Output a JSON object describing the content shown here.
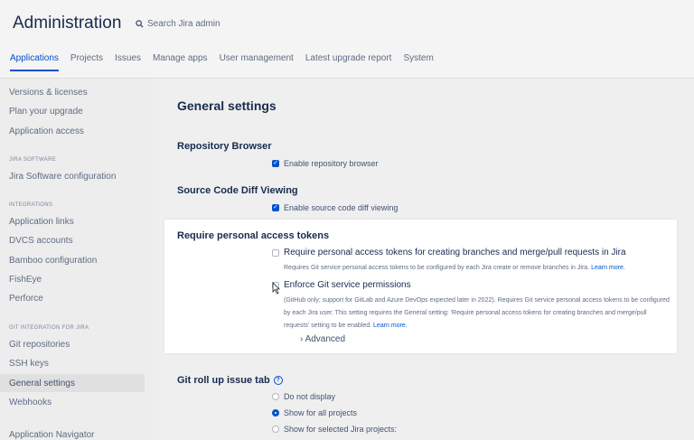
{
  "header": {
    "title": "Administration",
    "search_placeholder": "Search Jira admin",
    "tabs": [
      "Applications",
      "Projects",
      "Issues",
      "Manage apps",
      "User management",
      "Latest upgrade report",
      "System"
    ]
  },
  "sidebar": {
    "items_top": [
      "Versions & licenses",
      "Plan your upgrade",
      "Application access"
    ],
    "heading_jira_software": "JIRA SOFTWARE",
    "jira_software_items": [
      "Jira Software configuration"
    ],
    "heading_integrations": "INTEGRATIONS",
    "integration_items": [
      "Application links",
      "DVCS accounts",
      "Bamboo configuration",
      "FishEye",
      "Perforce"
    ],
    "heading_git": "GIT INTEGRATION FOR JIRA",
    "git_items": [
      "Git repositories",
      "SSH keys",
      "General settings",
      "Webhooks"
    ],
    "bottom_item": "Application Navigator"
  },
  "main": {
    "page_title": "General settings",
    "repo_browser": {
      "heading": "Repository Browser",
      "option": "Enable repository browser"
    },
    "diff_viewing": {
      "heading": "Source Code Diff Viewing",
      "option": "Enable source code diff viewing"
    },
    "pat": {
      "heading": "Require personal access tokens",
      "option1": "Require personal access tokens for creating branches and merge/pull requests in Jira",
      "option1_desc": "Requires Git service personal access tokens to be configured by each Jira create or remove branches in Jira.",
      "option1_link": "Learn more.",
      "option2": "Enforce Git service permissions",
      "option2_desc": "(GitHub only; support for GitLab and Azure DevOps expected later in 2022). Requires Git service personal access tokens to be configured by each Jira user. This setting requires the General setting: 'Require personal access tokens for creating branches and merge/pull requests' setting to be enabled.",
      "option2_link": "Learn more.",
      "advanced": "Advanced"
    },
    "rollup": {
      "heading": "Git roll up issue tab",
      "options": [
        "Do not display",
        "Show for all projects",
        "Show for selected Jira projects:"
      ]
    }
  },
  "colors": {
    "accent": "#0052cc",
    "text": "#172b4d"
  }
}
